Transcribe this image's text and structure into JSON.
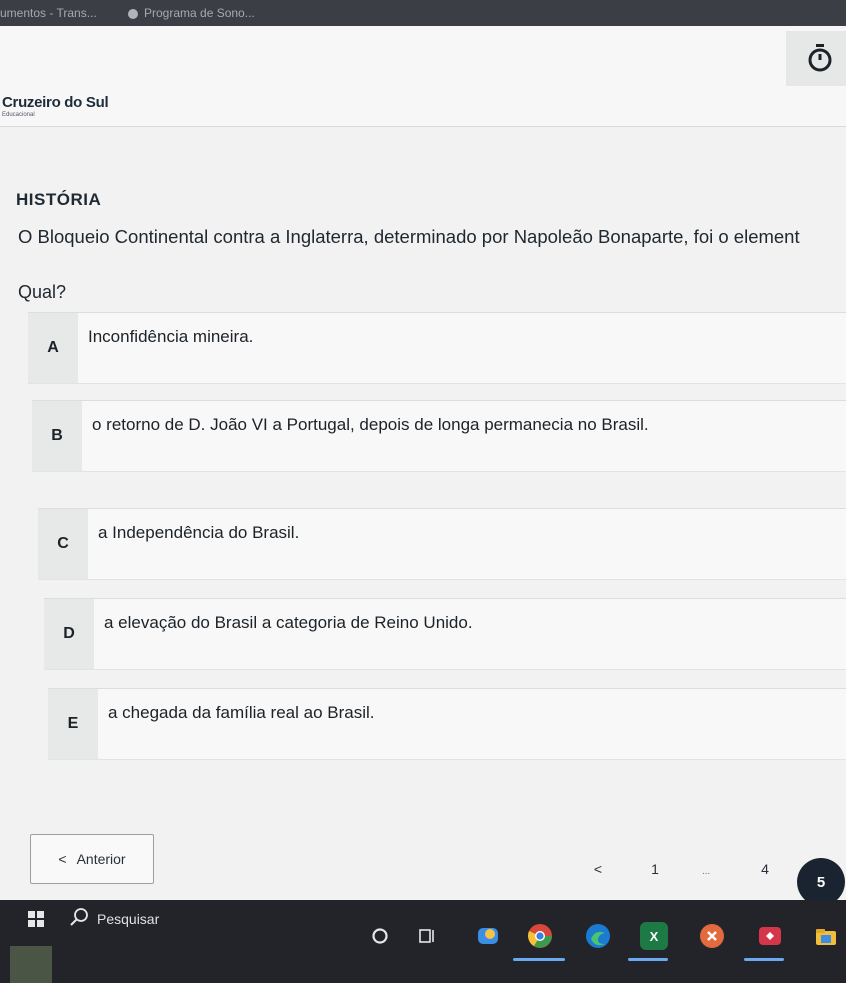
{
  "browser": {
    "tabs": [
      {
        "label": "umentos - Trans..."
      },
      {
        "label": "Programa de Sono..."
      }
    ]
  },
  "header": {
    "brand": "Cruzeiro do Sul",
    "brand_sub": "Educacional",
    "timer_icon": "stopwatch-icon"
  },
  "quiz": {
    "subject": "HISTÓRIA",
    "question": "O Bloqueio Continental contra a Inglaterra, determinado por Napoleão Bonaparte, foi o element",
    "prompt": "Qual?",
    "options": [
      {
        "letter": "A",
        "text": "Inconfidência mineira."
      },
      {
        "letter": "B",
        "text": "o retorno de D. João VI a Portugal, depois de longa permanecia no Brasil."
      },
      {
        "letter": "C",
        "text": "a Independência do Brasil."
      },
      {
        "letter": "D",
        "text": "a elevação do Brasil a categoria de Reino Unido."
      },
      {
        "letter": "E",
        "text": "a chegada da família real ao Brasil."
      }
    ]
  },
  "navigation": {
    "prev_label": "Anterior",
    "prev_arrow": "<",
    "pages": [
      "<",
      "1",
      "...",
      "4",
      "5"
    ],
    "current_page": "5"
  },
  "taskbar": {
    "search_placeholder": "Pesquisar",
    "apps": [
      "cortana-icon",
      "task-view-icon",
      "widgets-icon",
      "chrome-icon",
      "edge-icon",
      "excel-icon",
      "app-icon-orange",
      "app-icon-red",
      "explorer-icon"
    ],
    "excel_label": "X"
  },
  "colors": {
    "page_bg": "#f1f2f1",
    "letter_bg": "#e7e9e8",
    "current_page_bg": "#1a2330",
    "taskbar_bg": "#222429"
  }
}
